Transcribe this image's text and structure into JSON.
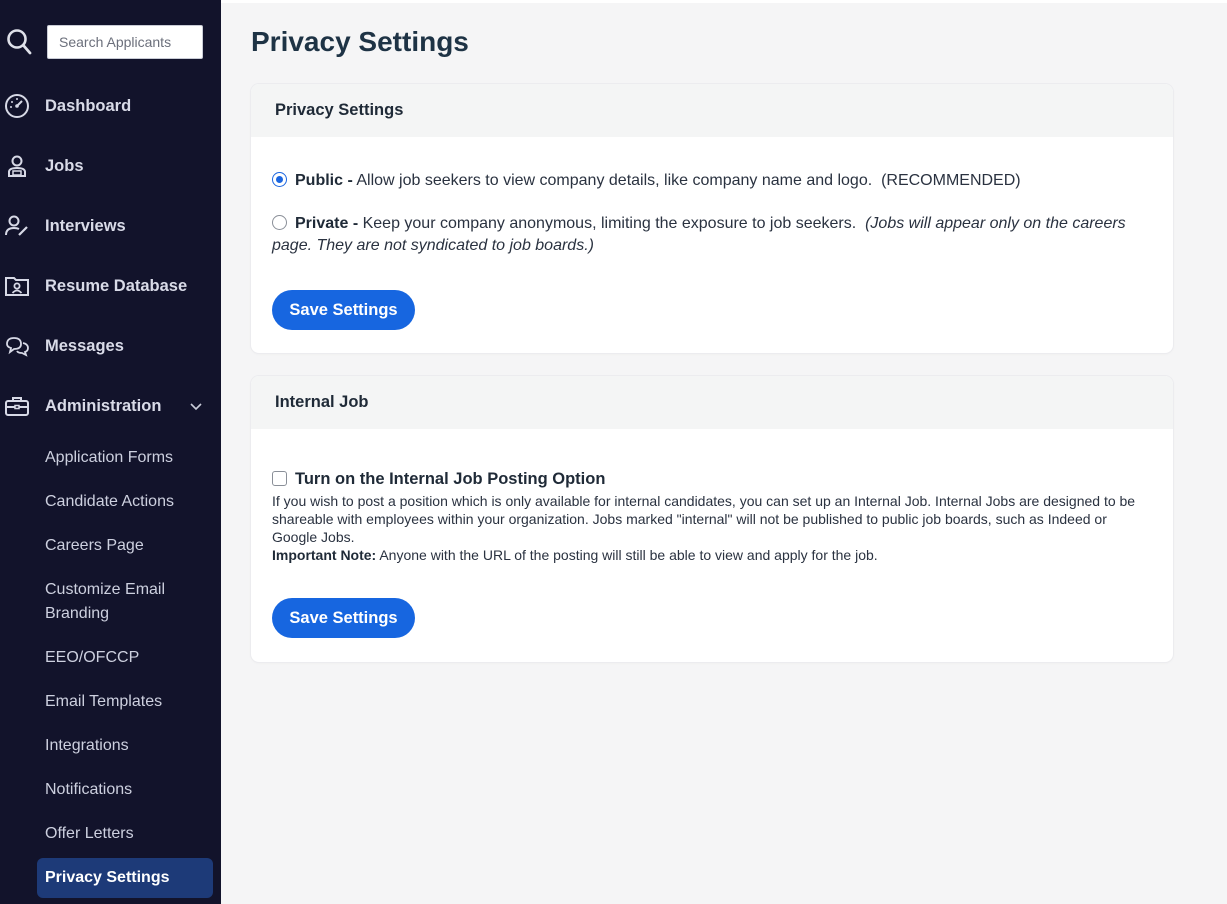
{
  "search": {
    "placeholder": "Search Applicants"
  },
  "nav": {
    "dashboard": "Dashboard",
    "jobs": "Jobs",
    "interviews": "Interviews",
    "resume_database": "Resume Database",
    "messages": "Messages",
    "administration": "Administration"
  },
  "admin_items": {
    "application_forms": "Application Forms",
    "candidate_actions": "Candidate Actions",
    "careers_page": "Careers Page",
    "customize_email_branding": "Customize Email Branding",
    "eeo_ofccp": "EEO/OFCCP",
    "email_templates": "Email Templates",
    "integrations": "Integrations",
    "notifications": "Notifications",
    "offer_letters": "Offer Letters",
    "privacy_settings": "Privacy Settings"
  },
  "page": {
    "title": "Privacy Settings"
  },
  "privacy_card": {
    "header": "Privacy Settings",
    "public_label": "Public -",
    "public_desc": "Allow job seekers to view company details, like company name and logo.",
    "public_note": "(RECOMMENDED)",
    "private_label": "Private -",
    "private_desc": "Keep your company anonymous, limiting the exposure to job seekers.",
    "private_note": "(Jobs will appear only on the careers page. They are not syndicated to job boards.)",
    "selected": "public",
    "save_label": "Save Settings"
  },
  "internal_card": {
    "header": "Internal Job",
    "checkbox_label": "Turn on the Internal Job Posting Option",
    "checked": false,
    "description": "If you wish to post a position which is only available for internal candidates, you can set up an Internal Job. Internal Jobs are designed to be shareable with employees within your organization. Jobs marked \"internal\" will not be published to public job boards, such as Indeed or Google Jobs.",
    "note_label": "Important Note:",
    "note_text": "Anyone with the URL of the posting will still be able to view and apply for the job.",
    "save_label": "Save Settings"
  },
  "colors": {
    "sidebar_bg": "#12132b",
    "active_item_bg": "#1d3a78",
    "primary_button": "#1766e0",
    "page_bg": "#f5f5f6"
  }
}
